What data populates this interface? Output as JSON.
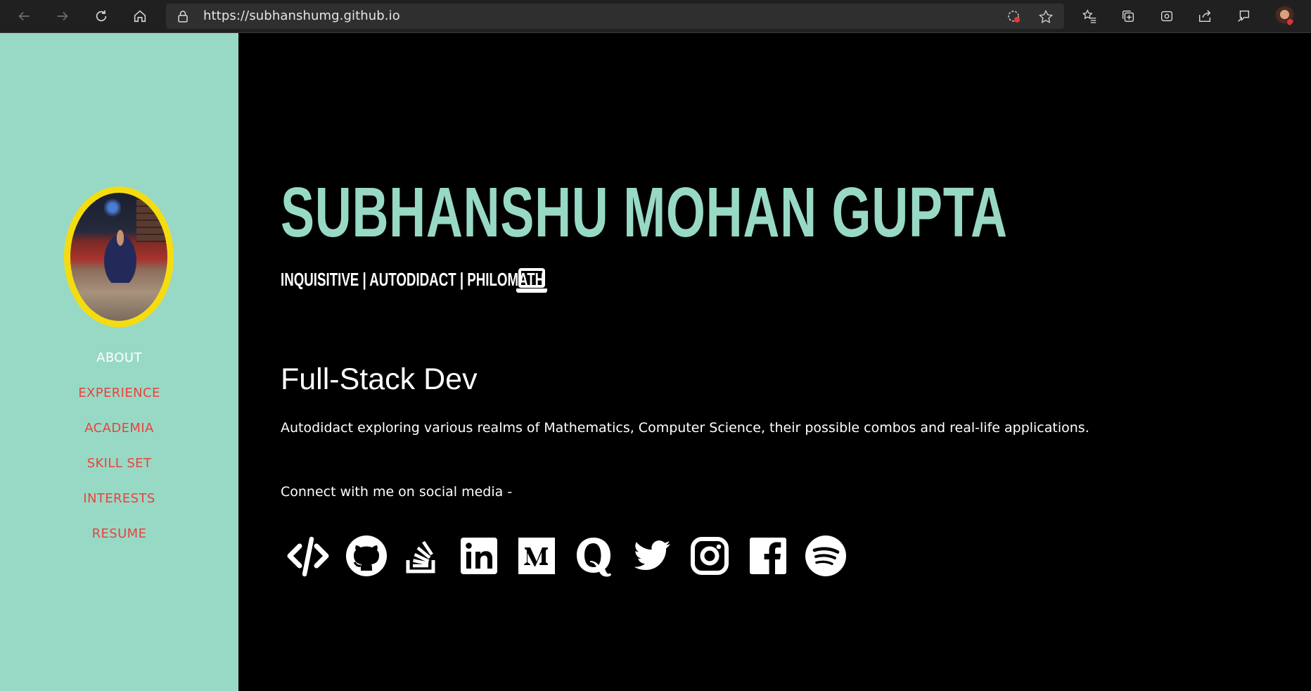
{
  "browser": {
    "url": "https://subhanshumg.github.io",
    "nav_icons": [
      "back-arrow-icon",
      "forward-arrow-icon",
      "refresh-icon",
      "home-icon"
    ],
    "toolbar_icons": [
      "tracking-prevention-icon",
      "favorite-star-icon",
      "favorites-list-icon",
      "collections-icon",
      "extensions-icon",
      "share-icon",
      "feedback-icon"
    ],
    "colors": {
      "bar_bg": "#202020",
      "address_bg": "#2f2f2f",
      "text": "#e6e6e6"
    }
  },
  "sidebar": {
    "background": "#98d9c6",
    "avatar_ring_color": "#f5dc11",
    "items": [
      {
        "label": "ABOUT",
        "active": true
      },
      {
        "label": "EXPERIENCE",
        "active": false
      },
      {
        "label": "ACADEMIA",
        "active": false
      },
      {
        "label": "SKILL SET",
        "active": false
      },
      {
        "label": "INTERESTS",
        "active": false
      },
      {
        "label": "RESUME",
        "active": false
      }
    ],
    "active_color": "#ffffff",
    "link_color": "#e8433b"
  },
  "main": {
    "name": "SUBHANSHU MOHAN GUPTA",
    "tagline": "INQUISITIVE | AUTODIDACT | PHILOMATH",
    "tagline_icon": "laptop-icon",
    "role": "Full-Stack Dev",
    "bio": "Autodidact exploring various realms of Mathematics, Computer Science, their possible combos and real-life applications.",
    "connect_text": "Connect with me on social media -",
    "social_icons": [
      "code-icon",
      "github-icon",
      "stackoverflow-icon",
      "linkedin-icon",
      "medium-icon",
      "quora-icon",
      "twitter-icon",
      "instagram-icon",
      "facebook-icon",
      "spotify-icon"
    ],
    "accent_color": "#98d9c6"
  }
}
